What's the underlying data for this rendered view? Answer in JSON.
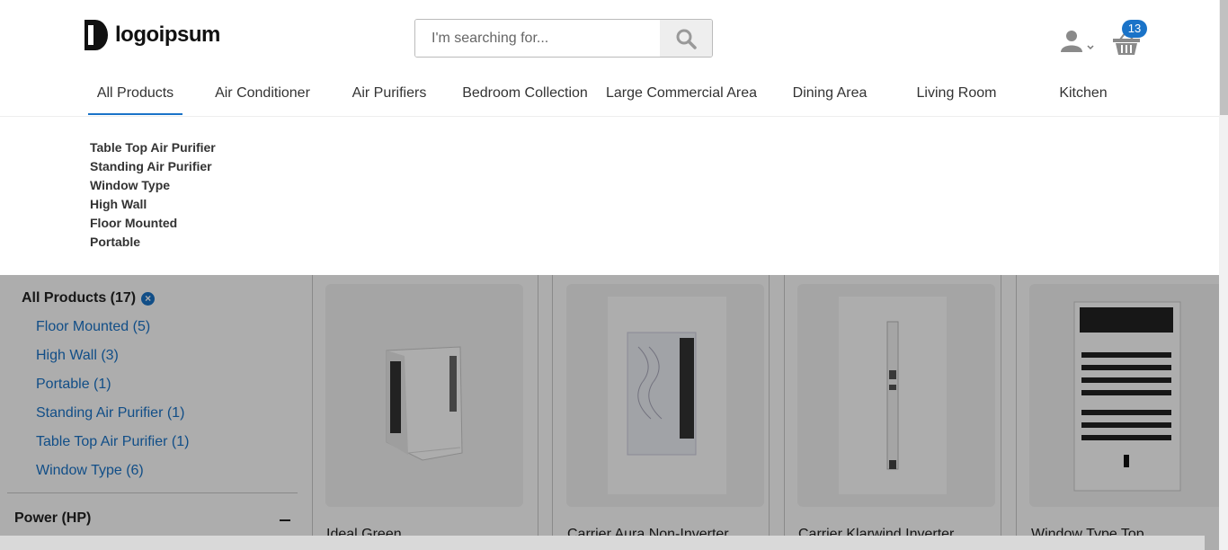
{
  "header": {
    "logo_text": "logoipsum",
    "search_placeholder": "I'm searching for...",
    "cart_count": "13"
  },
  "nav": {
    "items": [
      {
        "label": "All Products"
      },
      {
        "label": "Air Conditioner"
      },
      {
        "label": "Air Purifiers"
      },
      {
        "label": "Bedroom Collection"
      },
      {
        "label": "Large Commercial Area"
      },
      {
        "label": "Dining Area"
      },
      {
        "label": "Living Room"
      },
      {
        "label": "Kitchen"
      }
    ],
    "active": "All Products"
  },
  "dropdown": {
    "items": [
      {
        "label": "Table Top Air Purifier"
      },
      {
        "label": "Standing Air Purifier"
      },
      {
        "label": "Window Type"
      },
      {
        "label": "High Wall"
      },
      {
        "label": "Floor Mounted"
      },
      {
        "label": "Portable"
      }
    ]
  },
  "sidebar": {
    "category_heading": "All Products (17)",
    "categories": [
      {
        "label": "Floor Mounted (5)"
      },
      {
        "label": "High Wall (3)"
      },
      {
        "label": "Portable (1)"
      },
      {
        "label": "Standing Air Purifier (1)"
      },
      {
        "label": "Table Top Air Purifier (1)"
      },
      {
        "label": "Window Type (6)"
      }
    ],
    "facet_heading": "Power (HP)"
  },
  "products": [
    {
      "title": "Ideal Green"
    },
    {
      "title": "Carrier Aura Non-Inverter"
    },
    {
      "title": "Carrier Klarwind Inverter"
    },
    {
      "title": "Window Type Top"
    }
  ],
  "colors": {
    "accent": "#1a73c8"
  }
}
